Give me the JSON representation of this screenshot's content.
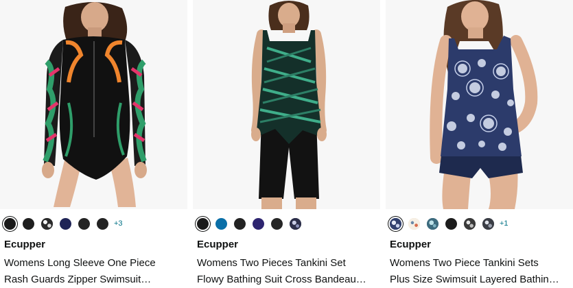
{
  "products": [
    {
      "brand": "Ecupper",
      "title_line1": "Womens Long Sleeve One Piece",
      "title_line2": "Rash Guards Zipper Swimsuit…",
      "swatch_colors": [
        "#1a1a1a",
        "#1f1f1f",
        "#2b2b2b",
        "#1f2456",
        "#232323",
        "#232323"
      ],
      "more_colors": "+3"
    },
    {
      "brand": "Ecupper",
      "title_line1": "Womens Two Pieces Tankini Set",
      "title_line2": "Flowy Bathing Suit Cross Bandeau…",
      "swatch_colors": [
        "#1a1a1a",
        "#0a6fa8",
        "#232323",
        "#2e2570",
        "#262626",
        "#2c2f4a"
      ]
    },
    {
      "brand": "Ecupper",
      "title_line1": "Womens Two Piece Tankini Sets",
      "title_line2": "Plus Size Swimsuit Layered Bathin…",
      "swatch_colors": [
        "#31406e",
        "#e8c49c",
        "#3d6b7e",
        "#1c1c1c",
        "#3a3a3a",
        "#3a3d45"
      ],
      "more_colors": "+1"
    }
  ],
  "colors": {
    "link": "#007185",
    "text": "#0f1111",
    "image_bg": "#f7f7f7"
  }
}
